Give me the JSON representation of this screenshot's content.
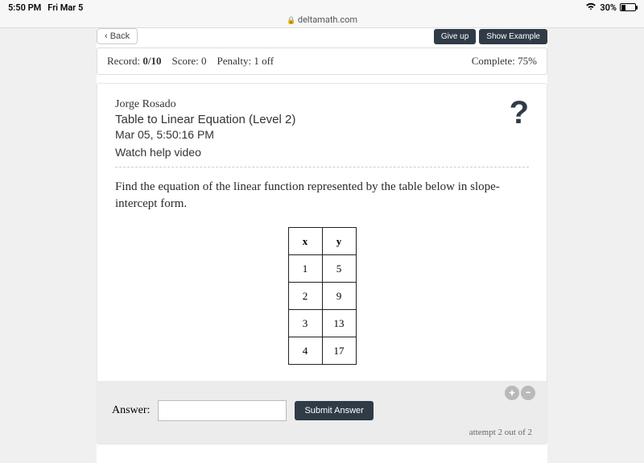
{
  "status": {
    "time": "5:50 PM",
    "date": "Fri Mar 5",
    "battery_percent": "30%"
  },
  "url": "deltamath.com",
  "toolbar": {
    "back": "‹ Back",
    "give_up": "Give up",
    "show_example": "Show Example"
  },
  "record_bar": {
    "record_label": "Record:",
    "record_value": "0/10",
    "score_label": "Score:",
    "score_value": "0",
    "penalty_label": "Penalty:",
    "penalty_value": "1 off",
    "complete_label": "Complete:",
    "complete_value": "75%"
  },
  "header": {
    "student": "Jorge Rosado",
    "assignment": "Table to Linear Equation (Level 2)",
    "timestamp": "Mar 05, 5:50:16 PM",
    "help_video": "Watch help video"
  },
  "question": "Find the equation of the linear function represented by the table below in slope-intercept form.",
  "table": {
    "headers": [
      "x",
      "y"
    ],
    "rows": [
      [
        "1",
        "5"
      ],
      [
        "2",
        "9"
      ],
      [
        "3",
        "13"
      ],
      [
        "4",
        "17"
      ]
    ]
  },
  "answer": {
    "label": "Answer:",
    "placeholder": "",
    "submit": "Submit Answer",
    "attempt": "attempt 2 out of 2"
  }
}
